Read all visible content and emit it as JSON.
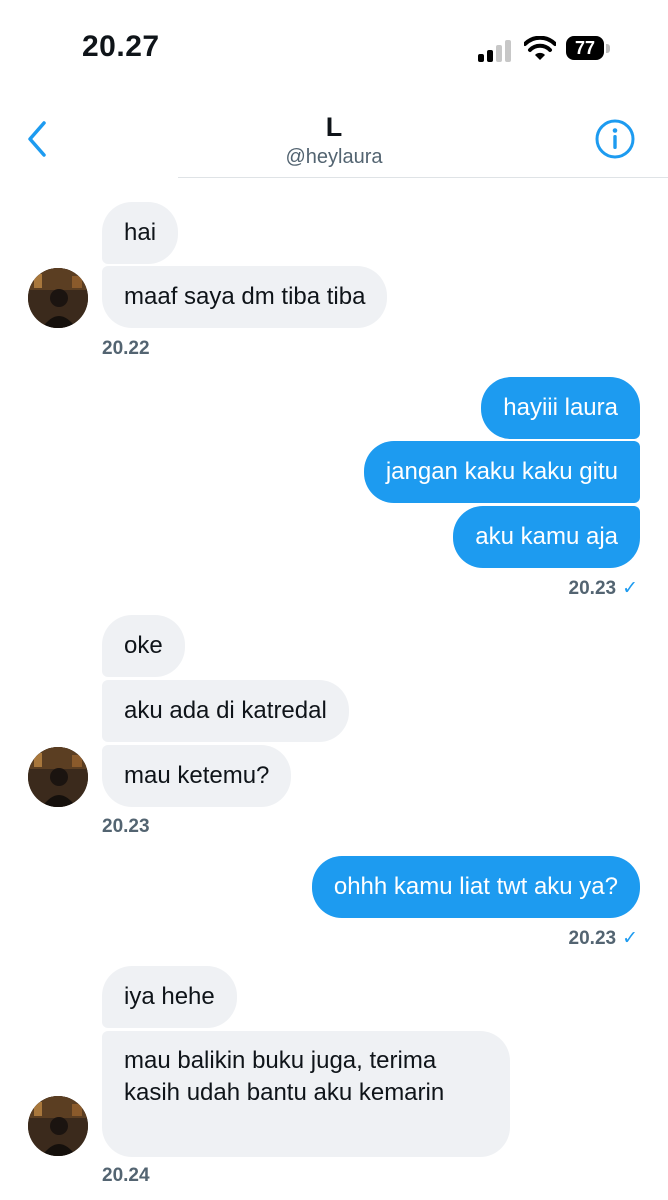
{
  "status_bar": {
    "time": "20.27",
    "battery": "77"
  },
  "header": {
    "name": "L",
    "handle": "@heylaura"
  },
  "messages": [
    {
      "text": "hai"
    },
    {
      "text": "maaf saya dm tiba tiba"
    },
    {
      "text": "hayiii laura"
    },
    {
      "text": "jangan kaku kaku gitu"
    },
    {
      "text": "aku kamu aja"
    },
    {
      "text": "oke"
    },
    {
      "text": "aku ada di katredal"
    },
    {
      "text": "mau ketemu?"
    },
    {
      "text": "ohhh kamu liat twt aku ya?"
    },
    {
      "text": "iya hehe"
    },
    {
      "text": "mau balikin buku juga, terima kasih udah bantu aku kemarin"
    }
  ],
  "timestamps": [
    "20.22",
    "20.23",
    "20.23",
    "20.23",
    "20.23",
    "20.24"
  ],
  "colors": {
    "accent": "#1d9bf0",
    "incoming_bubble": "#eff1f4",
    "meta_text": "#536471"
  }
}
